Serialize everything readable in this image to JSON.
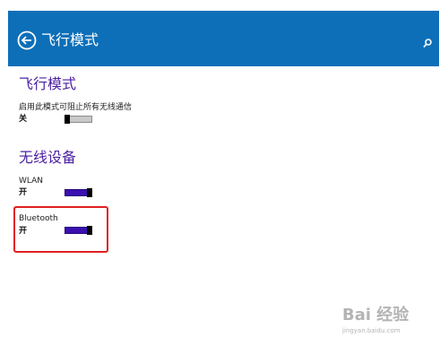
{
  "header": {
    "title": "飞行模式",
    "back_icon": "back-arrow-circle-icon",
    "search_icon": "search-icon",
    "background_color": "#0d6fb8"
  },
  "airplane_section": {
    "title": "飞行模式",
    "description": "启用此模式可阻止所有无线通信",
    "state": "关",
    "toggle_on": false
  },
  "wireless_section": {
    "title": "无线设备",
    "items": [
      {
        "label": "WLAN",
        "state": "开",
        "toggle_on": true
      },
      {
        "label": "Bluetooth",
        "state": "开",
        "toggle_on": true
      }
    ]
  },
  "colors": {
    "accent_heading": "#4b1fa3",
    "toggle_on": "#3b0fb0",
    "highlight_border": "#e02020"
  },
  "watermark": {
    "logo": "Bai 经验",
    "url": "jingyan.baidu.com"
  }
}
